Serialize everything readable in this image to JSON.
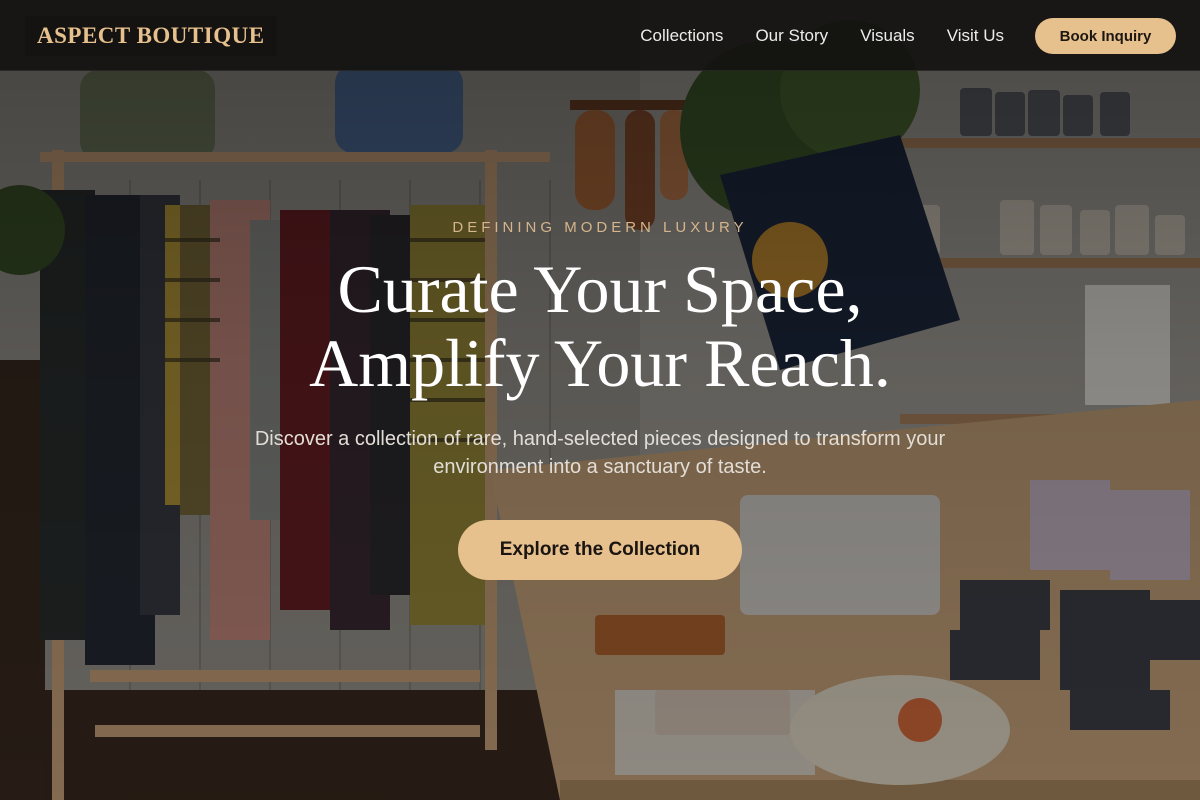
{
  "brand": {
    "name": "ASPECT BOUTIQUE"
  },
  "nav": {
    "links": [
      "Collections",
      "Our Story",
      "Visuals",
      "Visit Us"
    ],
    "cta_label": "Book Inquiry"
  },
  "hero": {
    "eyebrow": "DEFINING MODERN LUXURY",
    "headline_line1": "Curate Your Space,",
    "headline_line2": "Amplify Your Reach.",
    "subtext": "Discover a collection of rare, hand-selected pieces designed to transform your environment into a sanctuary of taste.",
    "cta_label": "Explore the Collection",
    "background_image": "boutique-interior-photo"
  },
  "colors": {
    "accent": "#e6c08d",
    "nav_bg": "#141211",
    "headline": "#ffffff",
    "eyebrow": "#d5b58c"
  }
}
